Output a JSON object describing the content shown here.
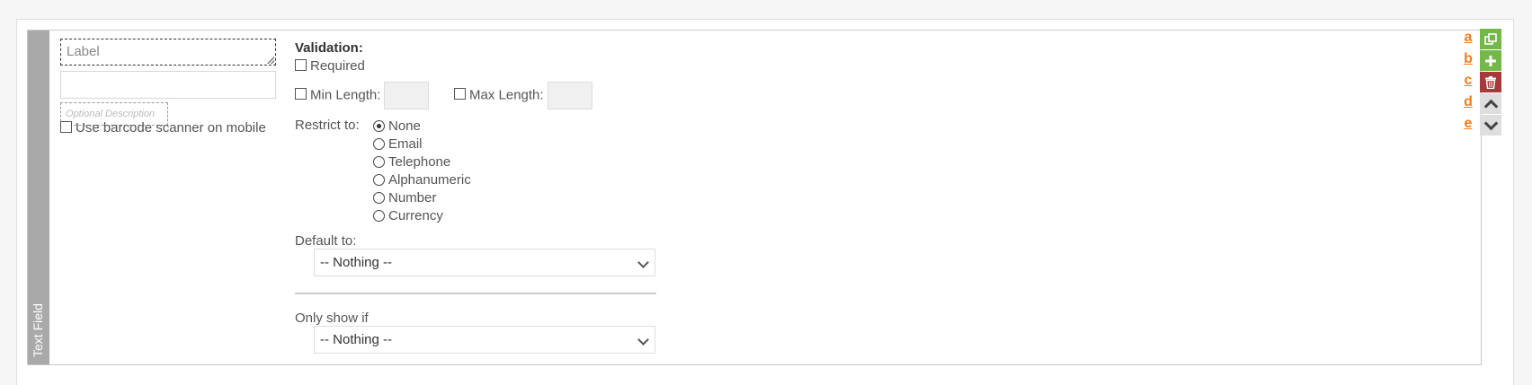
{
  "field_type": "Text Field",
  "label_placeholder": "Label",
  "description_placeholder": "Optional Description",
  "barcode_label": "Use barcode scanner on mobile",
  "validation": {
    "title": "Validation:",
    "required_label": "Required",
    "min_length_label": "Min Length:",
    "max_length_label": "Max Length:",
    "restrict_label": "Restrict to:",
    "restrict_options": [
      "None",
      "Email",
      "Telephone",
      "Alphanumeric",
      "Number",
      "Currency"
    ],
    "restrict_selected": "None"
  },
  "default_to": {
    "label": "Default to:",
    "value": "-- Nothing --"
  },
  "only_show_if": {
    "label": "Only show if",
    "value": "-- Nothing --"
  },
  "shortcuts": [
    "a",
    "b",
    "c",
    "d",
    "e"
  ],
  "actions": [
    "copy-icon",
    "plus-icon",
    "trash-icon",
    "chevron-up-icon",
    "chevron-down-icon"
  ],
  "colors": {
    "side_strip": "#a9a9a9",
    "accent_green": "#74b84a",
    "delete_red": "#a43a3a",
    "shortcut_orange": "#f07c1e"
  }
}
